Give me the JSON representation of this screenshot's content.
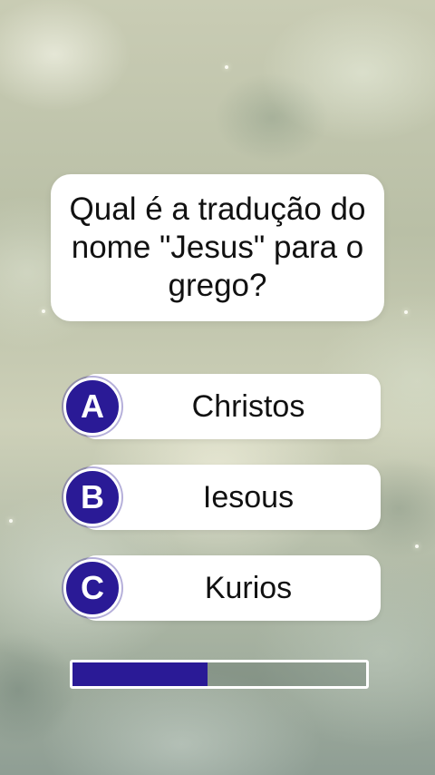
{
  "question": {
    "text": "Qual é a tradução do nome \"Jesus\" para o grego?"
  },
  "options": [
    {
      "letter": "A",
      "label": "Christos"
    },
    {
      "letter": "B",
      "label": "Iesous"
    },
    {
      "letter": "C",
      "label": "Kurios"
    }
  ],
  "timer": {
    "progress": 0.46
  },
  "colors": {
    "accent": "#2a1a96",
    "card": "#ffffff"
  }
}
